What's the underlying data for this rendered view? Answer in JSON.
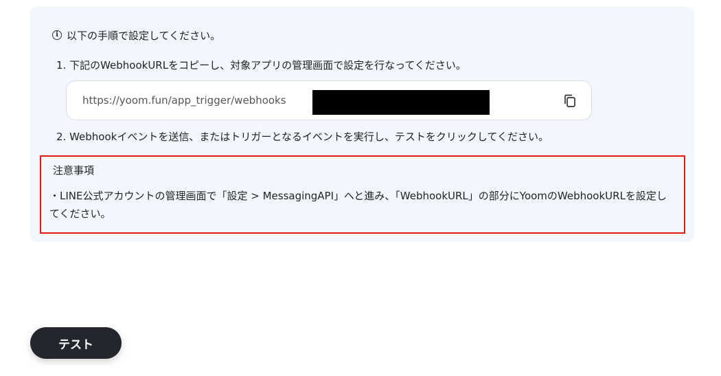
{
  "info": {
    "icon": "info-icon",
    "text": "以下の手順で設定してください。"
  },
  "steps": [
    "1. 下記のWebhookURLをコピーし、対象アプリの管理画面で設定を行なってください。",
    "2. Webhookイベントを送信、またはトリガーとなるイベントを実行し、テストをクリックしてください。"
  ],
  "webhook": {
    "url": "https://yoom.fun/app_trigger/webhooks",
    "copy_icon": "copy-icon"
  },
  "notice": {
    "title": "注意事項",
    "body": "・LINE公式アカウントの管理画面で「設定 > MessagingAPI」へと進み、「WebhookURL」の部分にYoomのWebhookURLを設定してください。",
    "border_color": "#e61515"
  },
  "actions": {
    "test_label": "テスト"
  },
  "colors": {
    "panel_bg": "#f2f7fe",
    "button_bg": "#23262c"
  }
}
